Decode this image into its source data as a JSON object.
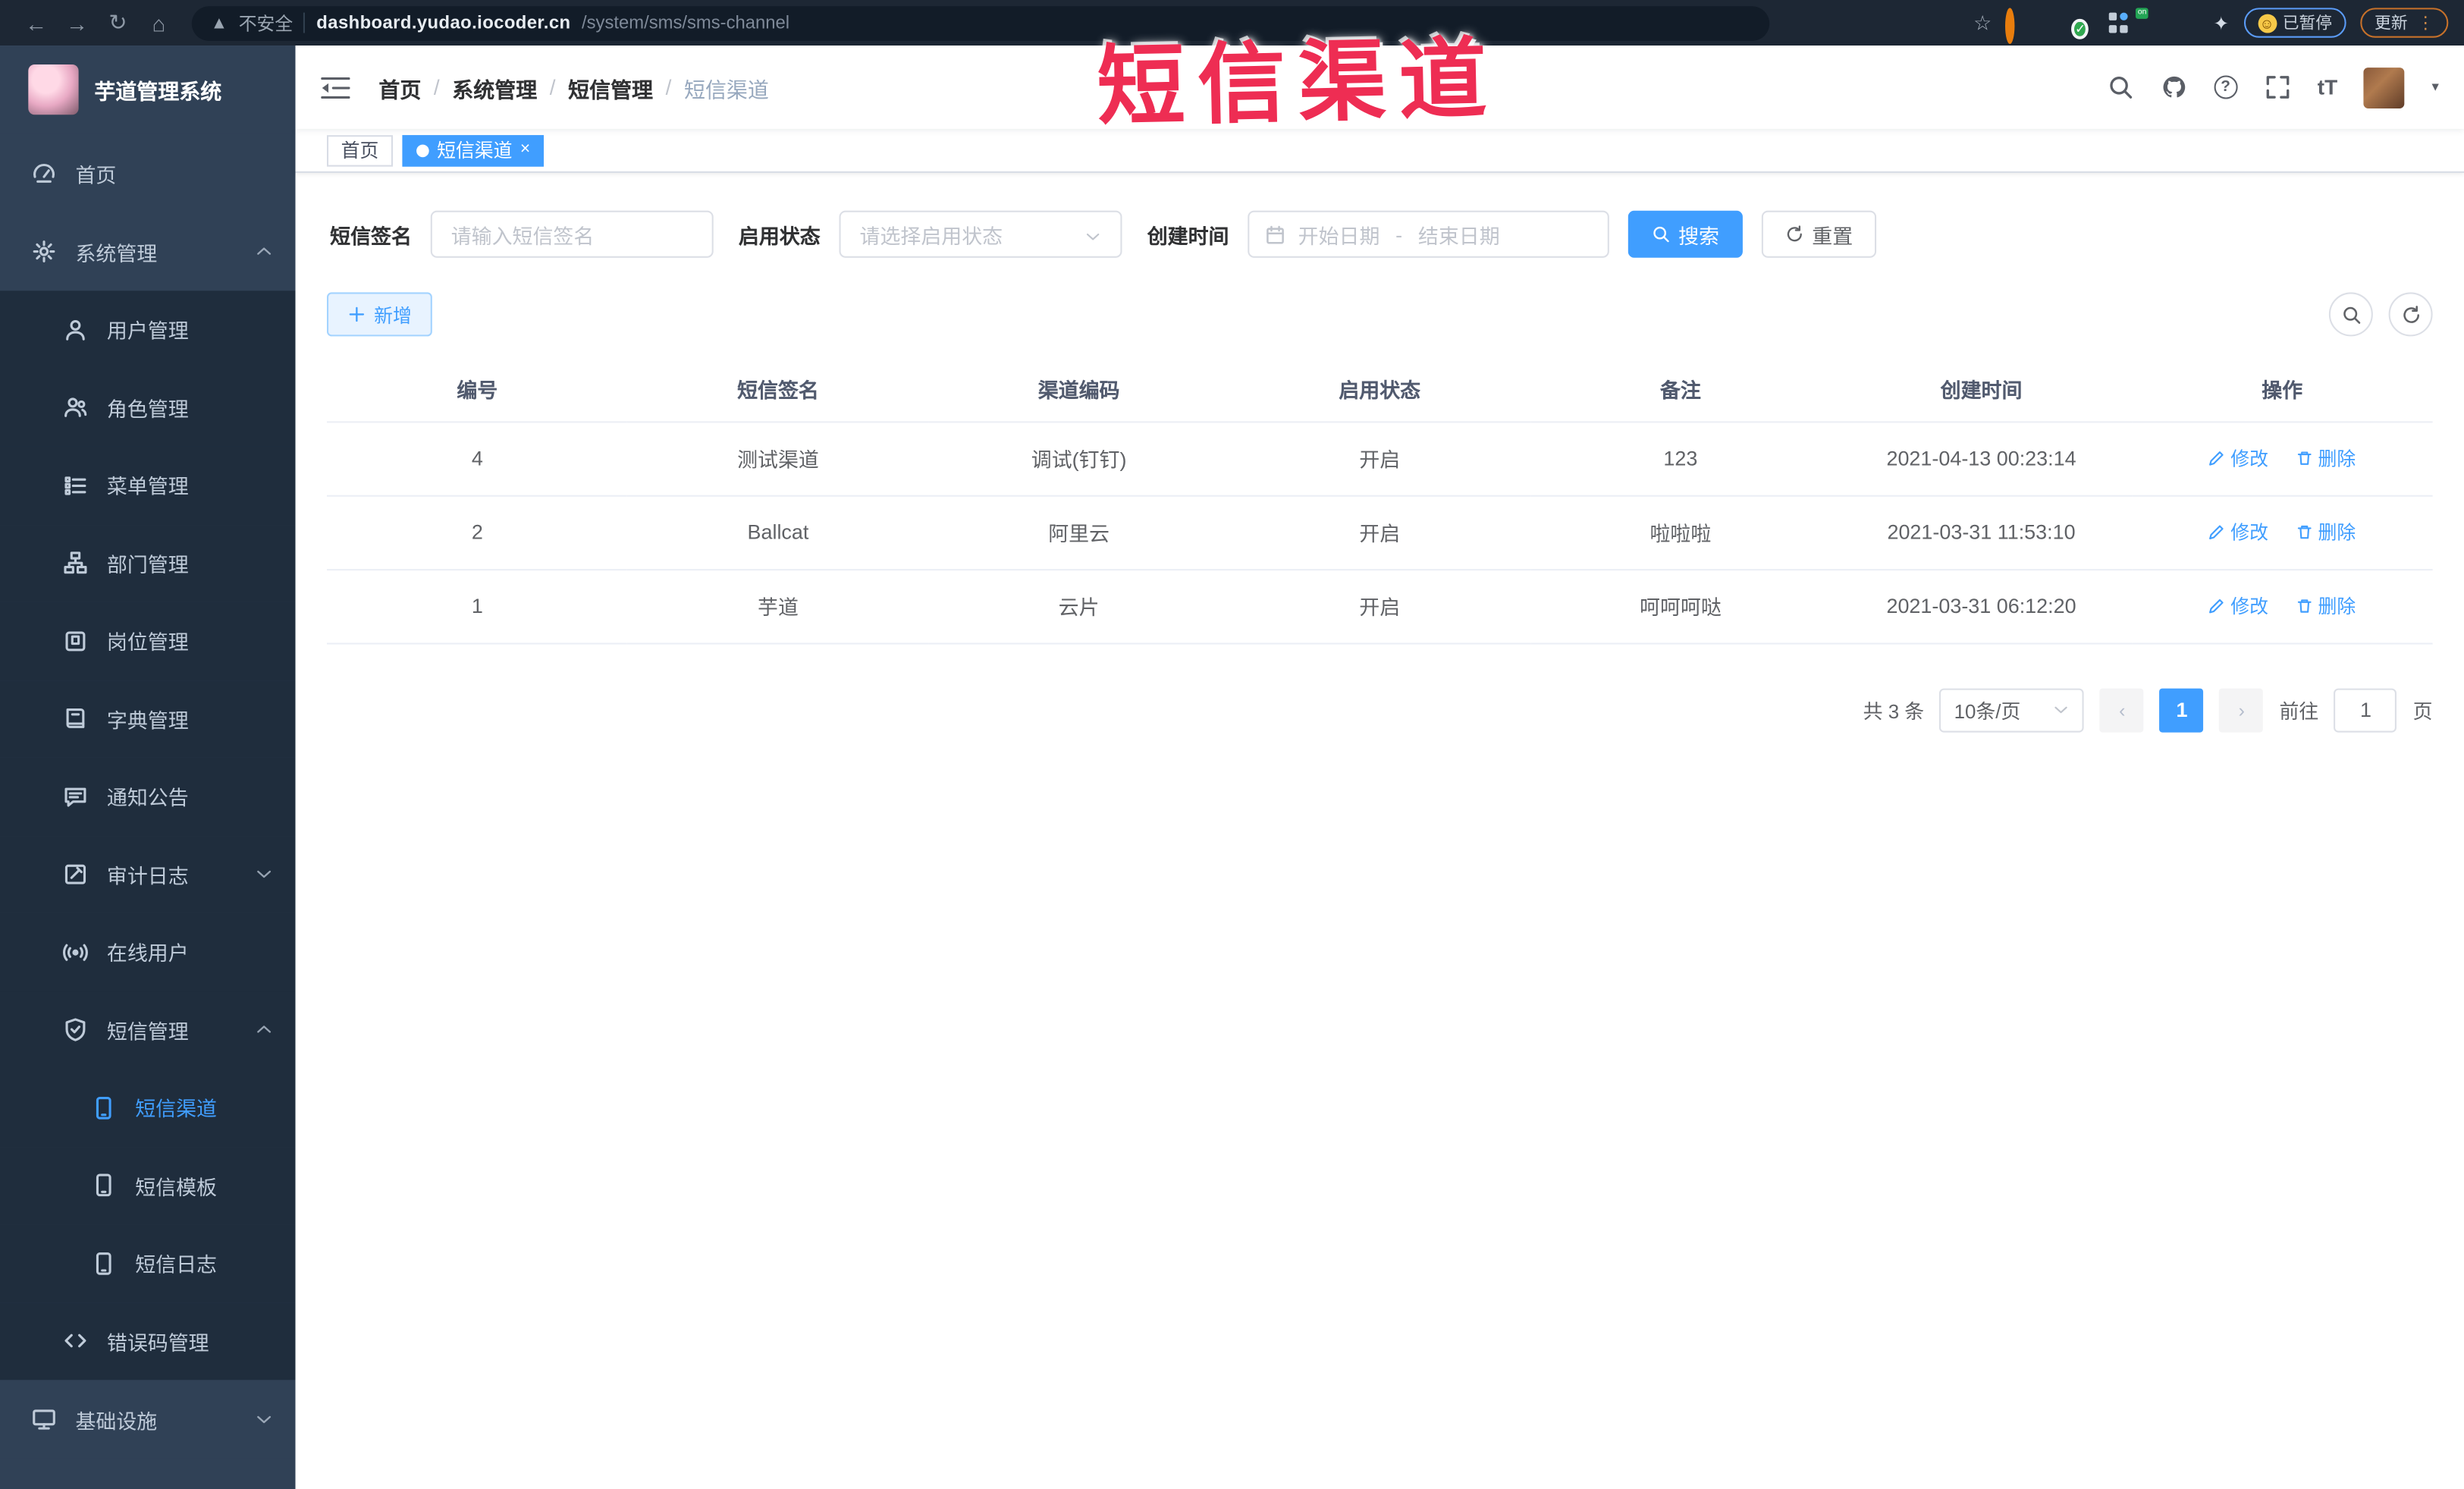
{
  "browser": {
    "security_label": "不安全",
    "url_host": "dashboard.yudao.iocoder.cn",
    "url_path": "/system/sms/sms-channel",
    "ext_on_badge": "on",
    "paused_label": "已暂停",
    "update_label": "更新"
  },
  "overlay": {
    "stamp_text": "短信渠道",
    "color": "#ee2d53"
  },
  "sidebar": {
    "app_title": "芋道管理系统",
    "items": [
      {
        "label": "首页"
      },
      {
        "label": "系统管理"
      },
      {
        "label": "用户管理"
      },
      {
        "label": "角色管理"
      },
      {
        "label": "菜单管理"
      },
      {
        "label": "部门管理"
      },
      {
        "label": "岗位管理"
      },
      {
        "label": "字典管理"
      },
      {
        "label": "通知公告"
      },
      {
        "label": "审计日志"
      },
      {
        "label": "在线用户"
      },
      {
        "label": "短信管理"
      },
      {
        "label": "短信渠道",
        "active": true
      },
      {
        "label": "短信模板"
      },
      {
        "label": "短信日志"
      },
      {
        "label": "错误码管理"
      },
      {
        "label": "基础设施"
      }
    ]
  },
  "header": {
    "breadcrumb": [
      "首页",
      "系统管理",
      "短信管理",
      "短信渠道"
    ],
    "fontsize_glyph": "tT"
  },
  "tabs": [
    {
      "label": "首页",
      "active": false
    },
    {
      "label": "短信渠道",
      "active": true
    }
  ],
  "filters": {
    "sign_label": "短信签名",
    "sign_placeholder": "请输入短信签名",
    "status_label": "启用状态",
    "status_placeholder": "请选择启用状态",
    "date_label": "创建时间",
    "date_start_placeholder": "开始日期",
    "date_separator": "-",
    "date_end_placeholder": "结束日期",
    "search_button": "搜索",
    "reset_button": "重置"
  },
  "toolbar": {
    "add_button": "新增"
  },
  "table": {
    "columns": [
      "编号",
      "短信签名",
      "渠道编码",
      "启用状态",
      "备注",
      "创建时间",
      "操作"
    ],
    "edit_label": "修改",
    "delete_label": "删除",
    "rows": [
      {
        "id": "4",
        "sign": "测试渠道",
        "code": "调试(钉钉)",
        "status": "开启",
        "remark": "123",
        "created": "2021-04-13 00:23:14"
      },
      {
        "id": "2",
        "sign": "Ballcat",
        "code": "阿里云",
        "status": "开启",
        "remark": "啦啦啦",
        "created": "2021-03-31 11:53:10"
      },
      {
        "id": "1",
        "sign": "芋道",
        "code": "云片",
        "status": "开启",
        "remark": "呵呵呵哒",
        "created": "2021-03-31 06:12:20"
      }
    ]
  },
  "pagination": {
    "total_text": "共 3 条",
    "page_size_text": "10条/页",
    "current_page": "1",
    "goto_label": "前往",
    "goto_value": "1",
    "page_unit": "页"
  }
}
